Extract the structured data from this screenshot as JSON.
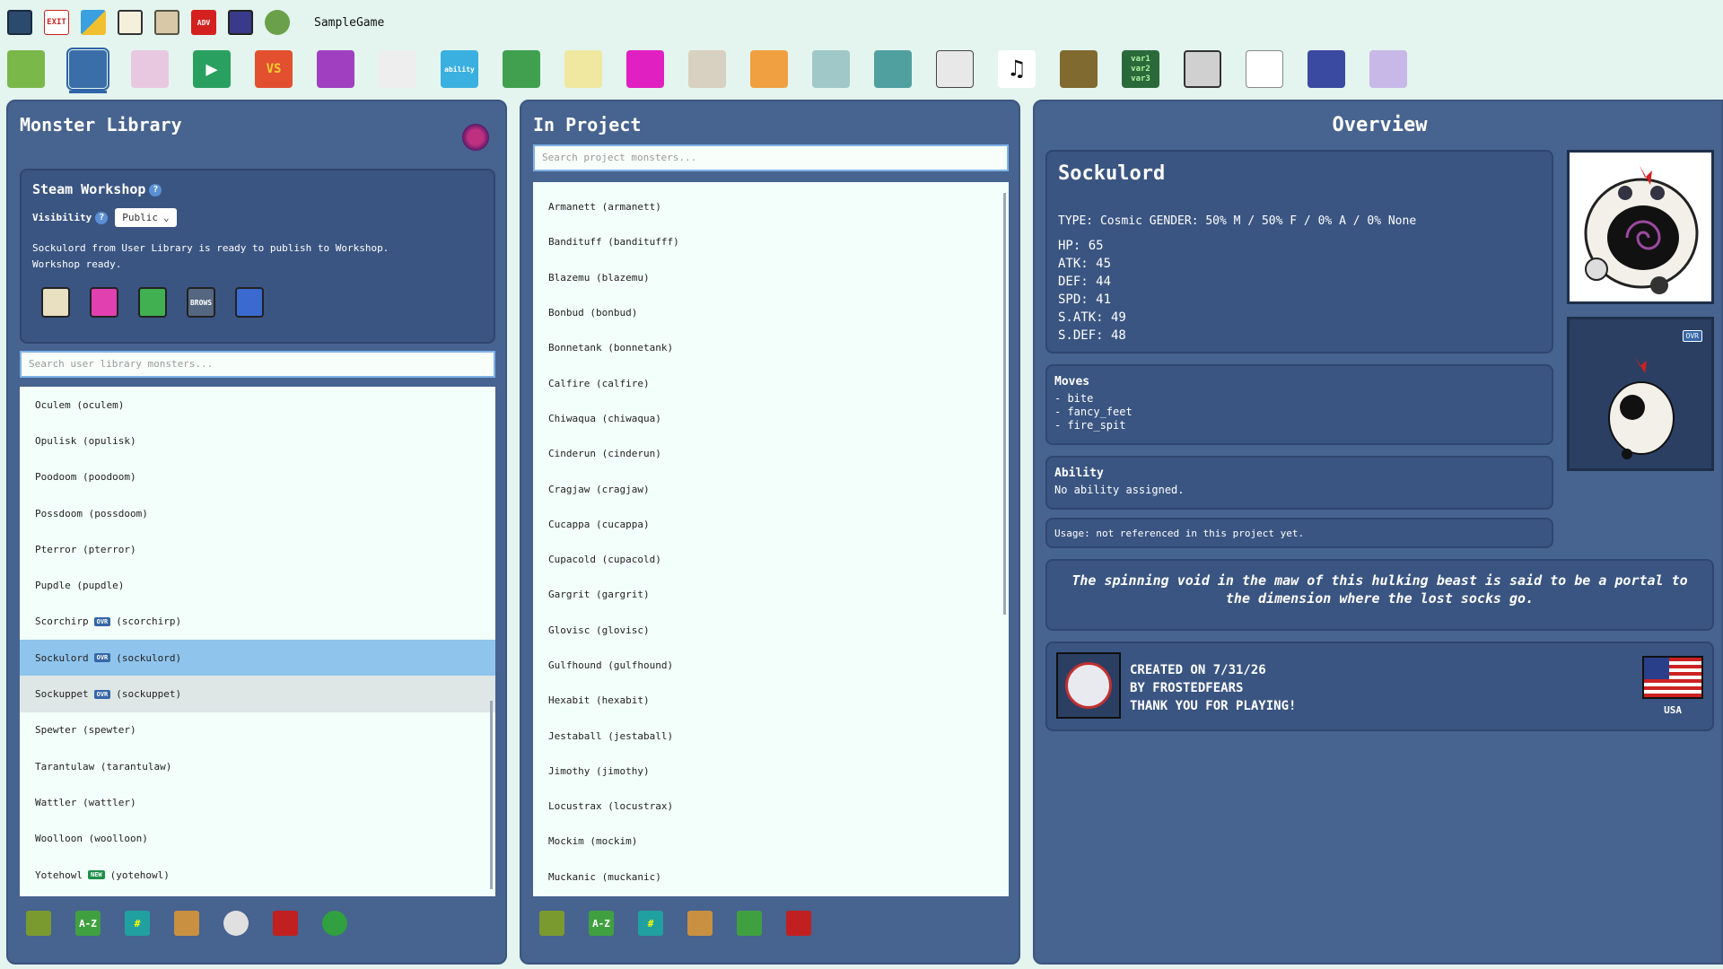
{
  "app": {
    "game_name": "SampleGame"
  },
  "top_toolbar": [
    {
      "name": "save-icon",
      "label": ""
    },
    {
      "name": "exit-icon",
      "label": "EXIT"
    },
    {
      "name": "edit-icon",
      "label": ""
    },
    {
      "name": "settings-panel-icon",
      "label": ""
    },
    {
      "name": "puzzle-icon",
      "label": ""
    },
    {
      "name": "adv-chat-icon",
      "label": "ADV"
    },
    {
      "name": "hierarchy-icon",
      "label": ""
    },
    {
      "name": "game-logo-icon",
      "label": ""
    }
  ],
  "tool_bar": [
    {
      "name": "map-tool-icon",
      "label": ""
    },
    {
      "name": "monster-tool-icon",
      "label": "",
      "active": true
    },
    {
      "name": "egg-tool-icon",
      "label": ""
    },
    {
      "name": "play-tool-icon",
      "label": "▶"
    },
    {
      "name": "vs-tool-icon",
      "label": "VS"
    },
    {
      "name": "fire-tool-icon",
      "label": ""
    },
    {
      "name": "animation-tool-icon",
      "label": ""
    },
    {
      "name": "ability-tool-icon",
      "label": "ability"
    },
    {
      "name": "item-tool-icon",
      "label": ""
    },
    {
      "name": "potion-tool-icon",
      "label": ""
    },
    {
      "name": "trainer-tool-icon",
      "label": ""
    },
    {
      "name": "npc-tool-icon",
      "label": ""
    },
    {
      "name": "wrench-tool-icon",
      "label": ""
    },
    {
      "name": "terrain-tool-icon",
      "label": ""
    },
    {
      "name": "building-tool-icon",
      "label": ""
    },
    {
      "name": "script-tool-icon",
      "label": ""
    },
    {
      "name": "music-tool-icon",
      "label": "♫"
    },
    {
      "name": "art-tool-icon",
      "label": ""
    },
    {
      "name": "variables-tool-icon",
      "label": "var1\nvar2\nvar3"
    },
    {
      "name": "screen-tool-icon",
      "label": ""
    },
    {
      "name": "dialogue-tool-icon",
      "label": ""
    },
    {
      "name": "type-chart-tool-icon",
      "label": ""
    },
    {
      "name": "plugin-tool-icon",
      "label": ""
    }
  ],
  "library": {
    "title": "Monster Library",
    "workshop": {
      "title": "Steam Workshop",
      "help": "?",
      "visibility_label": "Visibility",
      "visibility_value": "Public",
      "message_line1": "Sockulord from User Library is ready to publish to Workshop.",
      "message_line2": "Workshop ready.",
      "icons": [
        "save-icon",
        "steam-pink-icon",
        "steam-green-icon",
        "browse-icon",
        "steam-blue-icon"
      ],
      "browse_label": "BROWS"
    },
    "search_placeholder": "Search user library monsters...",
    "items": [
      {
        "name": "Oculem",
        "id": "(oculem)",
        "badge": ""
      },
      {
        "name": "Opulisk",
        "id": "(opulisk)",
        "badge": ""
      },
      {
        "name": "Poodoom",
        "id": "(poodoom)",
        "badge": ""
      },
      {
        "name": "Possdoom",
        "id": "(possdoom)",
        "badge": ""
      },
      {
        "name": "Pterror",
        "id": "(pterror)",
        "badge": ""
      },
      {
        "name": "Pupdle",
        "id": "(pupdle)",
        "badge": ""
      },
      {
        "name": "Scorchirp",
        "id": "(scorchirp)",
        "badge": "OVR"
      },
      {
        "name": "Sockulord",
        "id": "(sockulord)",
        "badge": "OVR",
        "selected": true
      },
      {
        "name": "Sockuppet",
        "id": "(sockuppet)",
        "badge": "OVR",
        "hovered": true
      },
      {
        "name": "Spewter",
        "id": "(spewter)",
        "badge": ""
      },
      {
        "name": "Tarantulaw",
        "id": "(tarantulaw)",
        "badge": ""
      },
      {
        "name": "Wattler",
        "id": "(wattler)",
        "badge": ""
      },
      {
        "name": "Woolloon",
        "id": "(woolloon)",
        "badge": ""
      },
      {
        "name": "Yotehowl",
        "id": "(yotehowl)",
        "badge": "NEW"
      }
    ],
    "bottom_icons": [
      {
        "name": "random-sort-icon",
        "label": ""
      },
      {
        "name": "az-sort-icon",
        "label": "A-Z"
      },
      {
        "name": "number-sort-icon",
        "label": "#"
      },
      {
        "name": "import-icon",
        "label": ""
      },
      {
        "name": "skull-icon",
        "label": ""
      },
      {
        "name": "delete-icon",
        "label": ""
      },
      {
        "name": "refresh-icon",
        "label": ""
      }
    ]
  },
  "project": {
    "title": "In Project",
    "search_placeholder": "Search project monsters...",
    "items": [
      "Armanett (armanett)",
      "Bandituff (banditufff)",
      "Blazemu (blazemu)",
      "Bonbud (bonbud)",
      "Bonnetank (bonnetank)",
      "Calfire (calfire)",
      "Chiwaqua (chiwaqua)",
      "Cinderun (cinderun)",
      "Cragjaw (cragjaw)",
      "Cucappa (cucappa)",
      "Cupacold (cupacold)",
      "Gargrit (gargrit)",
      "Glovisc (glovisc)",
      "Gulfhound (gulfhound)",
      "Hexabit (hexabit)",
      "Jestaball (jestaball)",
      "Jimothy (jimothy)",
      "Locustrax (locustrax)",
      "Mockim (mockim)",
      "Muckanic (muckanic)"
    ],
    "bottom_icons": [
      {
        "name": "random-sort-icon",
        "label": ""
      },
      {
        "name": "az-sort-icon",
        "label": "A-Z"
      },
      {
        "name": "number-sort-icon",
        "label": "#"
      },
      {
        "name": "import-icon",
        "label": ""
      },
      {
        "name": "add-icon",
        "label": ""
      },
      {
        "name": "delete-icon",
        "label": ""
      }
    ]
  },
  "overview": {
    "title": "Overview",
    "name": "Sockulord",
    "type_line": "TYPE: Cosmic  GENDER: 50% M / 50% F / 0% A / 0% None",
    "stats": [
      "HP: 65",
      "ATK: 45",
      "DEF: 44",
      "SPD: 41",
      "S.ATK: 49",
      "S.DEF: 48"
    ],
    "moves_title": "Moves",
    "moves": [
      "- bite",
      "- fancy_feet",
      "- fire_spit"
    ],
    "ability_title": "Ability",
    "ability_text": "No ability assigned.",
    "usage": "Usage: not referenced in this project yet.",
    "description": "The spinning void in the maw of this hulking beast is said to be a portal to the dimension where the lost socks go.",
    "credit_line1": "CREATED ON 7/31/26",
    "credit_line2": "BY FROSTEDFEARS",
    "credit_line3": "THANK YOU FOR PLAYING!",
    "country": "USA",
    "ovr_tag": "OVR"
  }
}
